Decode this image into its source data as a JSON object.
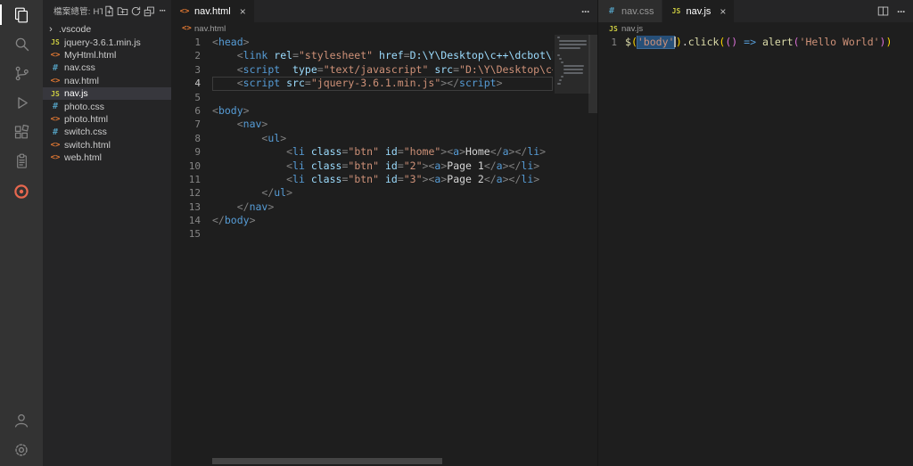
{
  "labels": {
    "more": "···",
    "close": "×",
    "folder_chevron": "›"
  },
  "colors": {
    "accent_html": "#e37933",
    "accent_css": "#519aba",
    "accent_js": "#cbcb41",
    "selection": "#264f78",
    "extension_accent": "#e8684f",
    "sidebar_selected_bg": "#37373d"
  },
  "activity_bar": {
    "top": [
      {
        "name": "explorer",
        "active": true
      },
      {
        "name": "search"
      },
      {
        "name": "source-control"
      },
      {
        "name": "run-and-debug"
      },
      {
        "name": "extensions"
      },
      {
        "name": "testing"
      },
      {
        "name": "browser-preview",
        "accent": true
      }
    ],
    "bottom": [
      {
        "name": "accounts"
      },
      {
        "name": "manage"
      }
    ]
  },
  "sidebar": {
    "title": "檔案總管: HTML",
    "actions": [
      "new-file",
      "new-folder",
      "refresh",
      "collapse-all",
      "more"
    ],
    "files": [
      {
        "label": ".vscode",
        "type": "folder"
      },
      {
        "label": "jquery-3.6.1.min.js",
        "type": "js"
      },
      {
        "label": "MyHtml.html",
        "type": "html"
      },
      {
        "label": "nav.css",
        "type": "css"
      },
      {
        "label": "nav.html",
        "type": "html"
      },
      {
        "label": "nav.js",
        "type": "js",
        "selected": true
      },
      {
        "label": "photo.css",
        "type": "css"
      },
      {
        "label": "photo.html",
        "type": "html"
      },
      {
        "label": "switch.css",
        "type": "css"
      },
      {
        "label": "switch.html",
        "type": "html"
      },
      {
        "label": "web.html",
        "type": "html"
      }
    ]
  },
  "left_editor": {
    "tabs": [
      {
        "label": "nav.html",
        "type": "html",
        "active": true
      }
    ],
    "breadcrumb": {
      "label": "nav.html",
      "type": "html"
    },
    "code": [
      {
        "tokens": [
          [
            "p",
            "<"
          ],
          [
            "tag",
            "head"
          ],
          [
            "p",
            ">"
          ]
        ]
      },
      {
        "tokens": [
          [
            "txt",
            "    "
          ],
          [
            "p",
            "<"
          ],
          [
            "tag",
            "link"
          ],
          [
            "txt",
            " "
          ],
          [
            "attr",
            "rel"
          ],
          [
            "p",
            "="
          ],
          [
            "str",
            "\"stylesheet\""
          ],
          [
            "txt",
            " "
          ],
          [
            "attr",
            "href"
          ],
          [
            "p",
            "="
          ],
          [
            "attr",
            "D:\\Y\\Desktop\\c++\\dcbot\\html\\"
          ]
        ]
      },
      {
        "tokens": [
          [
            "txt",
            "    "
          ],
          [
            "p",
            "<"
          ],
          [
            "tag",
            "script"
          ],
          [
            "txt",
            "  "
          ],
          [
            "attr",
            "type"
          ],
          [
            "p",
            "="
          ],
          [
            "str",
            "\"text/javascript\""
          ],
          [
            "txt",
            " "
          ],
          [
            "attr",
            "src"
          ],
          [
            "p",
            "="
          ],
          [
            "str",
            "\"D:\\Y\\Desktop\\c++\\dc"
          ]
        ]
      },
      {
        "active": true,
        "tokens": [
          [
            "txt",
            "    "
          ],
          [
            "p",
            "<"
          ],
          [
            "tag",
            "script"
          ],
          [
            "txt",
            " "
          ],
          [
            "attr",
            "src"
          ],
          [
            "p",
            "="
          ],
          [
            "str",
            "\"jquery-3.6.1.min.js\""
          ],
          [
            "p",
            "></"
          ],
          [
            "tag",
            "script"
          ],
          [
            "p",
            ">"
          ]
        ]
      },
      {
        "tokens": []
      },
      {
        "tokens": [
          [
            "p",
            "<"
          ],
          [
            "tag",
            "body"
          ],
          [
            "p",
            ">"
          ]
        ]
      },
      {
        "tokens": [
          [
            "txt",
            "    "
          ],
          [
            "p",
            "<"
          ],
          [
            "tag",
            "nav"
          ],
          [
            "p",
            ">"
          ]
        ]
      },
      {
        "tokens": [
          [
            "txt",
            "        "
          ],
          [
            "p",
            "<"
          ],
          [
            "tag",
            "ul"
          ],
          [
            "p",
            ">"
          ]
        ]
      },
      {
        "tokens": [
          [
            "txt",
            "            "
          ],
          [
            "p",
            "<"
          ],
          [
            "tag",
            "li"
          ],
          [
            "txt",
            " "
          ],
          [
            "attr",
            "class"
          ],
          [
            "p",
            "="
          ],
          [
            "str",
            "\"btn\""
          ],
          [
            "txt",
            " "
          ],
          [
            "attr",
            "id"
          ],
          [
            "p",
            "="
          ],
          [
            "str",
            "\"home\""
          ],
          [
            "p",
            "><"
          ],
          [
            "tag",
            "a"
          ],
          [
            "p",
            ">"
          ],
          [
            "txt",
            "Home"
          ],
          [
            "p",
            "</"
          ],
          [
            "tag",
            "a"
          ],
          [
            "p",
            "></"
          ],
          [
            "tag",
            "li"
          ],
          [
            "p",
            ">"
          ]
        ]
      },
      {
        "tokens": [
          [
            "txt",
            "            "
          ],
          [
            "p",
            "<"
          ],
          [
            "tag",
            "li"
          ],
          [
            "txt",
            " "
          ],
          [
            "attr",
            "class"
          ],
          [
            "p",
            "="
          ],
          [
            "str",
            "\"btn\""
          ],
          [
            "txt",
            " "
          ],
          [
            "attr",
            "id"
          ],
          [
            "p",
            "="
          ],
          [
            "str",
            "\"2\""
          ],
          [
            "p",
            "><"
          ],
          [
            "tag",
            "a"
          ],
          [
            "p",
            ">"
          ],
          [
            "txt",
            "Page 1"
          ],
          [
            "p",
            "</"
          ],
          [
            "tag",
            "a"
          ],
          [
            "p",
            "></"
          ],
          [
            "tag",
            "li"
          ],
          [
            "p",
            ">"
          ]
        ]
      },
      {
        "tokens": [
          [
            "txt",
            "            "
          ],
          [
            "p",
            "<"
          ],
          [
            "tag",
            "li"
          ],
          [
            "txt",
            " "
          ],
          [
            "attr",
            "class"
          ],
          [
            "p",
            "="
          ],
          [
            "str",
            "\"btn\""
          ],
          [
            "txt",
            " "
          ],
          [
            "attr",
            "id"
          ],
          [
            "p",
            "="
          ],
          [
            "str",
            "\"3\""
          ],
          [
            "p",
            "><"
          ],
          [
            "tag",
            "a"
          ],
          [
            "p",
            ">"
          ],
          [
            "txt",
            "Page 2"
          ],
          [
            "p",
            "</"
          ],
          [
            "tag",
            "a"
          ],
          [
            "p",
            "></"
          ],
          [
            "tag",
            "li"
          ],
          [
            "p",
            ">"
          ]
        ]
      },
      {
        "tokens": [
          [
            "txt",
            "        "
          ],
          [
            "p",
            "</"
          ],
          [
            "tag",
            "ul"
          ],
          [
            "p",
            ">"
          ]
        ]
      },
      {
        "tokens": [
          [
            "txt",
            "    "
          ],
          [
            "p",
            "</"
          ],
          [
            "tag",
            "nav"
          ],
          [
            "p",
            ">"
          ]
        ]
      },
      {
        "tokens": [
          [
            "p",
            "</"
          ],
          [
            "tag",
            "body"
          ],
          [
            "p",
            ">"
          ]
        ]
      },
      {
        "tokens": []
      }
    ]
  },
  "right_editor": {
    "tabs": [
      {
        "label": "nav.css",
        "type": "css",
        "active": false
      },
      {
        "label": "nav.js",
        "type": "js",
        "active": true
      }
    ],
    "breadcrumb": {
      "label": "nav.js",
      "type": "js"
    },
    "code": [
      {
        "tokens": [
          [
            "fn",
            "$"
          ],
          [
            "b1",
            "("
          ],
          [
            "str sel",
            "'body'"
          ],
          [
            "cursor",
            ""
          ],
          [
            "b1",
            ")"
          ],
          [
            "txt",
            "."
          ],
          [
            "fn",
            "click"
          ],
          [
            "b1",
            "("
          ],
          [
            "b2",
            "("
          ],
          [
            "b2",
            ")"
          ],
          [
            "txt",
            " "
          ],
          [
            "kw",
            "=>"
          ],
          [
            "txt",
            " "
          ],
          [
            "fn",
            "alert"
          ],
          [
            "b2",
            "("
          ],
          [
            "str",
            "'Hello World'"
          ],
          [
            "b2",
            ")"
          ],
          [
            "b1",
            ")"
          ]
        ]
      }
    ]
  }
}
